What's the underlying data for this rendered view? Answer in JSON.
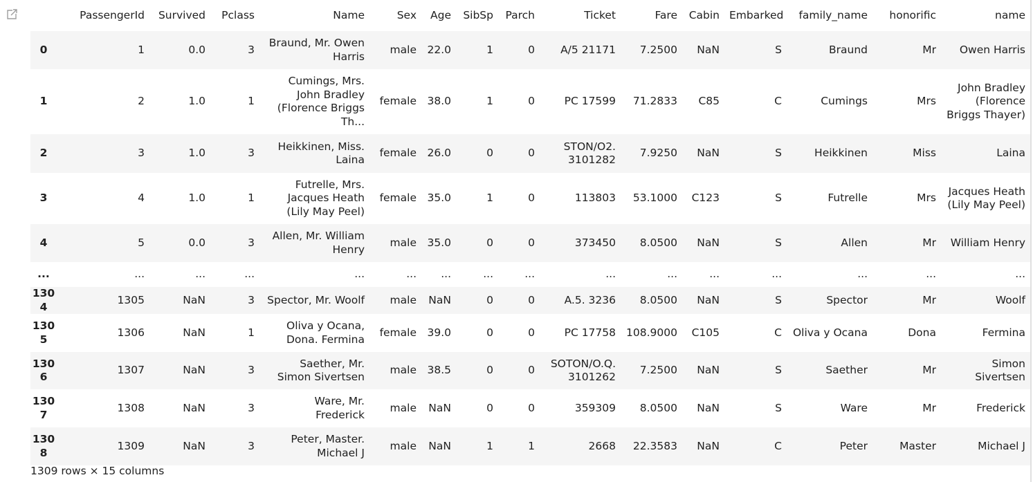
{
  "columns": [
    "",
    "PassengerId",
    "Survived",
    "Pclass",
    "Name",
    "Sex",
    "Age",
    "SibSp",
    "Parch",
    "Ticket",
    "Fare",
    "Cabin",
    "Embarked",
    "family_name",
    "honorific",
    "name"
  ],
  "rows": [
    [
      "0",
      "1",
      "0.0",
      "3",
      "Braund, Mr. Owen Harris",
      "male",
      "22.0",
      "1",
      "0",
      "A/5 21171",
      "7.2500",
      "NaN",
      "S",
      "Braund",
      "Mr",
      "Owen Harris"
    ],
    [
      "1",
      "2",
      "1.0",
      "1",
      "Cumings, Mrs. John Bradley (Florence Briggs Th...",
      "female",
      "38.0",
      "1",
      "0",
      "PC 17599",
      "71.2833",
      "C85",
      "C",
      "Cumings",
      "Mrs",
      "John Bradley (Florence Briggs Thayer)"
    ],
    [
      "2",
      "3",
      "1.0",
      "3",
      "Heikkinen, Miss. Laina",
      "female",
      "26.0",
      "0",
      "0",
      "STON/O2. 3101282",
      "7.9250",
      "NaN",
      "S",
      "Heikkinen",
      "Miss",
      "Laina"
    ],
    [
      "3",
      "4",
      "1.0",
      "1",
      "Futrelle, Mrs. Jacques Heath (Lily May Peel)",
      "female",
      "35.0",
      "1",
      "0",
      "113803",
      "53.1000",
      "C123",
      "S",
      "Futrelle",
      "Mrs",
      "Jacques Heath (Lily May Peel)"
    ],
    [
      "4",
      "5",
      "0.0",
      "3",
      "Allen, Mr. William Henry",
      "male",
      "35.0",
      "0",
      "0",
      "373450",
      "8.0500",
      "NaN",
      "S",
      "Allen",
      "Mr",
      "William Henry"
    ],
    [
      "...",
      "...",
      "...",
      "...",
      "...",
      "...",
      "...",
      "...",
      "...",
      "...",
      "...",
      "...",
      "...",
      "...",
      "...",
      "..."
    ],
    [
      "1304",
      "1305",
      "NaN",
      "3",
      "Spector, Mr. Woolf",
      "male",
      "NaN",
      "0",
      "0",
      "A.5. 3236",
      "8.0500",
      "NaN",
      "S",
      "Spector",
      "Mr",
      "Woolf"
    ],
    [
      "1305",
      "1306",
      "NaN",
      "1",
      "Oliva y Ocana, Dona. Fermina",
      "female",
      "39.0",
      "0",
      "0",
      "PC 17758",
      "108.9000",
      "C105",
      "C",
      "Oliva y Ocana",
      "Dona",
      "Fermina"
    ],
    [
      "1306",
      "1307",
      "NaN",
      "3",
      "Saether, Mr. Simon Sivertsen",
      "male",
      "38.5",
      "0",
      "0",
      "SOTON/O.Q. 3101262",
      "7.2500",
      "NaN",
      "S",
      "Saether",
      "Mr",
      "Simon Sivertsen"
    ],
    [
      "1307",
      "1308",
      "NaN",
      "3",
      "Ware, Mr. Frederick",
      "male",
      "NaN",
      "0",
      "0",
      "359309",
      "8.0500",
      "NaN",
      "S",
      "Ware",
      "Mr",
      "Frederick"
    ],
    [
      "1308",
      "1309",
      "NaN",
      "3",
      "Peter, Master. Michael J",
      "male",
      "NaN",
      "1",
      "1",
      "2668",
      "22.3583",
      "NaN",
      "C",
      "Peter",
      "Master",
      "Michael J"
    ]
  ],
  "footer": "1309 rows × 15 columns",
  "icons": {
    "output": "output-cell-icon"
  },
  "colors": {
    "stripe": "#f5f5f5",
    "text": "#212121",
    "icon": "#9e9e9e"
  }
}
